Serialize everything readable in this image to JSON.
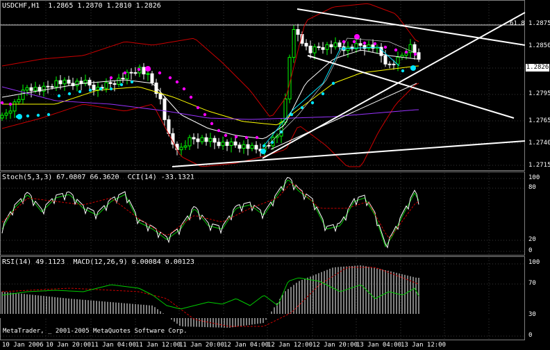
{
  "main": {
    "title": "USDCHF,H1  1.2865 1.2870 1.2810 1.2826",
    "price_ticks": [
      "1.2875",
      "1.2850",
      "1.2826",
      "1.2795",
      "1.2765",
      "1.2740",
      "1.2715"
    ],
    "current_price": "1.2826",
    "fib_label": "61.8"
  },
  "stoch": {
    "title": "Stoch(5,3,3) 67.0807 66.3620  CCI(14) -33.1321",
    "ticks": [
      "100",
      "80",
      "20",
      "0"
    ]
  },
  "rsi": {
    "title": "RSI(14) 49.1123  MACD(12,26,9) 0.00084 0.00123",
    "ticks": [
      "100",
      "70",
      "30",
      "0"
    ]
  },
  "time_ticks": [
    "10 Jan 2006",
    "10 Jan 20:00",
    "11 Jan 04:00",
    "11 Jan 12:00",
    "11 Jan 20:00",
    "12 Jan 04:00",
    "12 Jan 12:00",
    "12 Jan 20:00",
    "13 Jan 04:00",
    "13 Jan 12:00"
  ],
  "copyright": "MetaTrader, _ 2001-2005 MetaQuotes Software Corp.",
  "colors": {
    "background": "#000000",
    "bull_candle": "#00ff00",
    "bear_candle": "#ffffff",
    "bollinger": "#cc0000",
    "ma_white": "#ffffff",
    "ma_yellow": "#ffff00",
    "ma_purple": "#9933ff",
    "parabolic_magenta": "#ff00ff",
    "parabolic_cyan": "#00e5ff",
    "trendline": "#ffffff",
    "oscillator_green": "#00cc00",
    "signal_red": "#cc0000"
  }
}
